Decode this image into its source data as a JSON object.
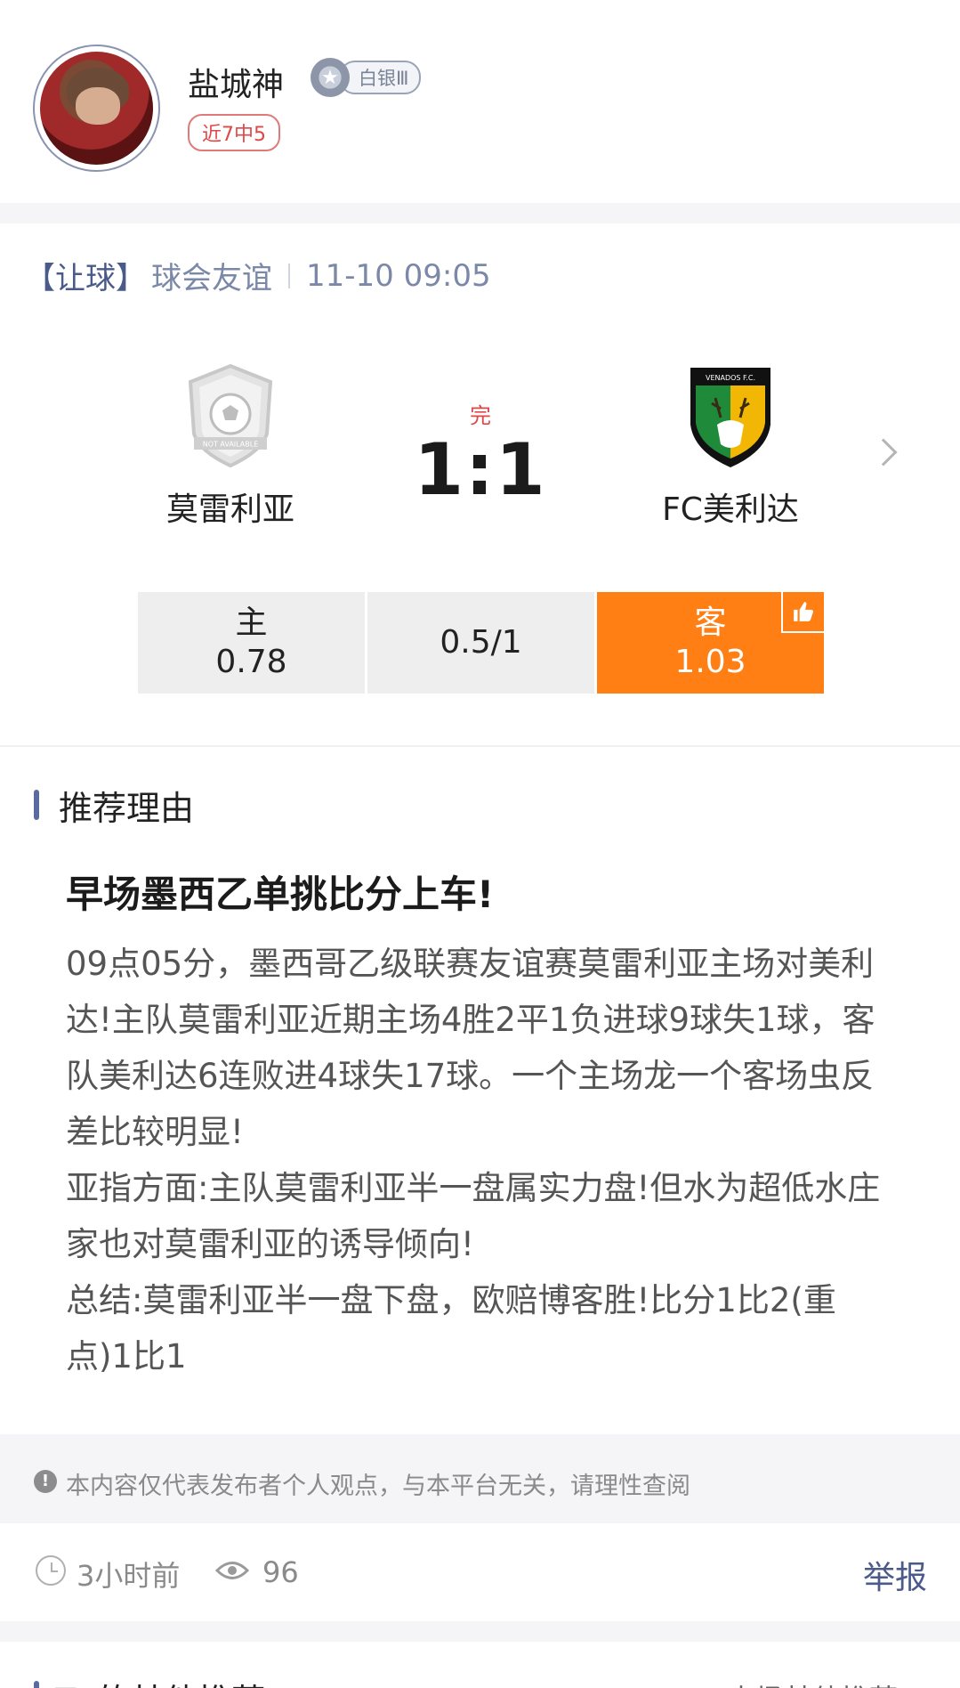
{
  "author": {
    "name": "盐城神",
    "rank": "白银Ⅲ",
    "streak": "近7中5"
  },
  "match": {
    "type": "【让球】",
    "league": "球会友谊",
    "datetime": "11-10  09:05",
    "status": "完",
    "score": "1:1",
    "home": {
      "name": "莫雷利亚",
      "logo_text": "NOT AVAILABLE"
    },
    "away": {
      "name": "FC美利达",
      "logo_text": "VENADOS F.C."
    },
    "odds": [
      {
        "label": "主",
        "value": "0.78"
      },
      {
        "label": "",
        "value": "0.5/1"
      },
      {
        "label": "客",
        "value": "1.03",
        "selected": true
      }
    ]
  },
  "reason": {
    "section_title": "推荐理由",
    "headline": "早场墨西乙单挑比分上车!",
    "body": [
      "09点05分，墨西哥乙级联赛友谊赛莫雷利亚主场对美利达!主队莫雷利亚近期主场4胜2平1负进球9球失1球，客队美利达6连败进4球失17球。一个主场龙一个客场虫反差比较明显!",
      "亚指方面:主队莫雷利亚半一盘属实力盘!但水为超低水庄家也对莫雷利亚的诱导倾向!",
      "总结:莫雷利亚半一盘下盘，欧赔博客胜!比分1比2(重点)1比1"
    ]
  },
  "disclaimer": "本内容仅代表发布者个人观点，与本平台无关，请理性查阅",
  "meta": {
    "time_ago": "3小时前",
    "views": "96",
    "report": "举报"
  },
  "others": {
    "title": "TA的其他推荐",
    "link": "本场其他推荐"
  },
  "colors": {
    "accent": "#ff7f15",
    "link": "#4a5a8a",
    "red": "#e04848"
  }
}
